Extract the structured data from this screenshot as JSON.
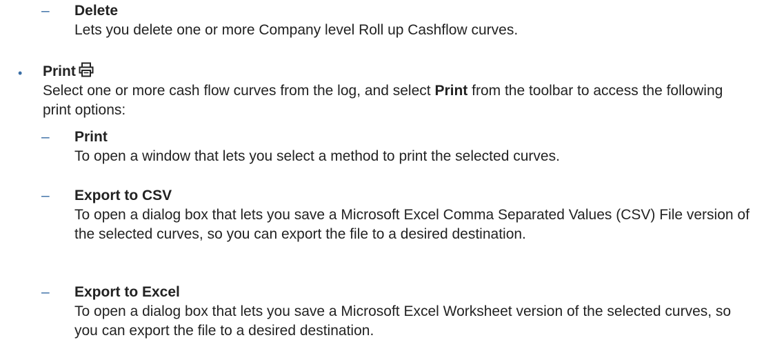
{
  "delete_item": {
    "title": "Delete",
    "description": "Lets you delete one or more Company level Roll up Cashflow curves."
  },
  "print_section": {
    "title": "Print",
    "icon": "printer-icon",
    "intro_before": "Select one or more cash flow curves from the log, and select ",
    "intro_bold": "Print",
    "intro_after": " from the toolbar to access the following print options:"
  },
  "options": [
    {
      "title": "Print",
      "description": "To open a window that lets you select a method to print the selected curves."
    },
    {
      "title": "Export to CSV",
      "description": "To open a dialog box that lets you save a Microsoft Excel Comma Separated Values (CSV) File version of the selected curves, so you can export the file to a desired destination."
    },
    {
      "title": "Export to Excel",
      "description": "To open a dialog box that lets you save a Microsoft Excel Worksheet version of the selected curves, so you can export the file to a desired destination."
    }
  ],
  "markers": {
    "bullet": "•",
    "dash": "–"
  },
  "colors": {
    "text": "#222222",
    "marker": "#3a6ea5"
  }
}
